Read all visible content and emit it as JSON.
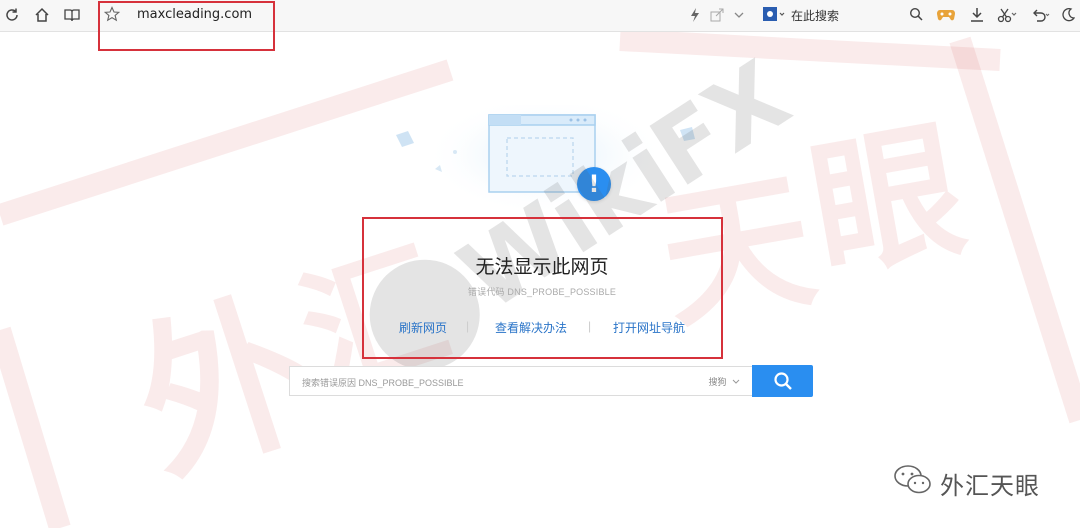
{
  "browser": {
    "address": "maxcleading.com",
    "search_placeholder": "在此搜索"
  },
  "error_page": {
    "title": "无法显示此网页",
    "error_code": "错误代码 DNS_PROBE_POSSIBLE",
    "links": [
      "刷新网页",
      "查看解决办法",
      "打开网址导航"
    ],
    "search_placeholder": "搜索错误原因 DNS_PROBE_POSSIBLE",
    "search_engine": "搜狗"
  },
  "watermark": {
    "brand": "WikiFX",
    "stamp_chars": [
      "外",
      "汇",
      "天",
      "眼"
    ],
    "caption": "外汇天眼"
  },
  "colors": {
    "accent": "#2a8ef0",
    "link": "#2a74c8",
    "highlight_box": "#d6313b"
  }
}
